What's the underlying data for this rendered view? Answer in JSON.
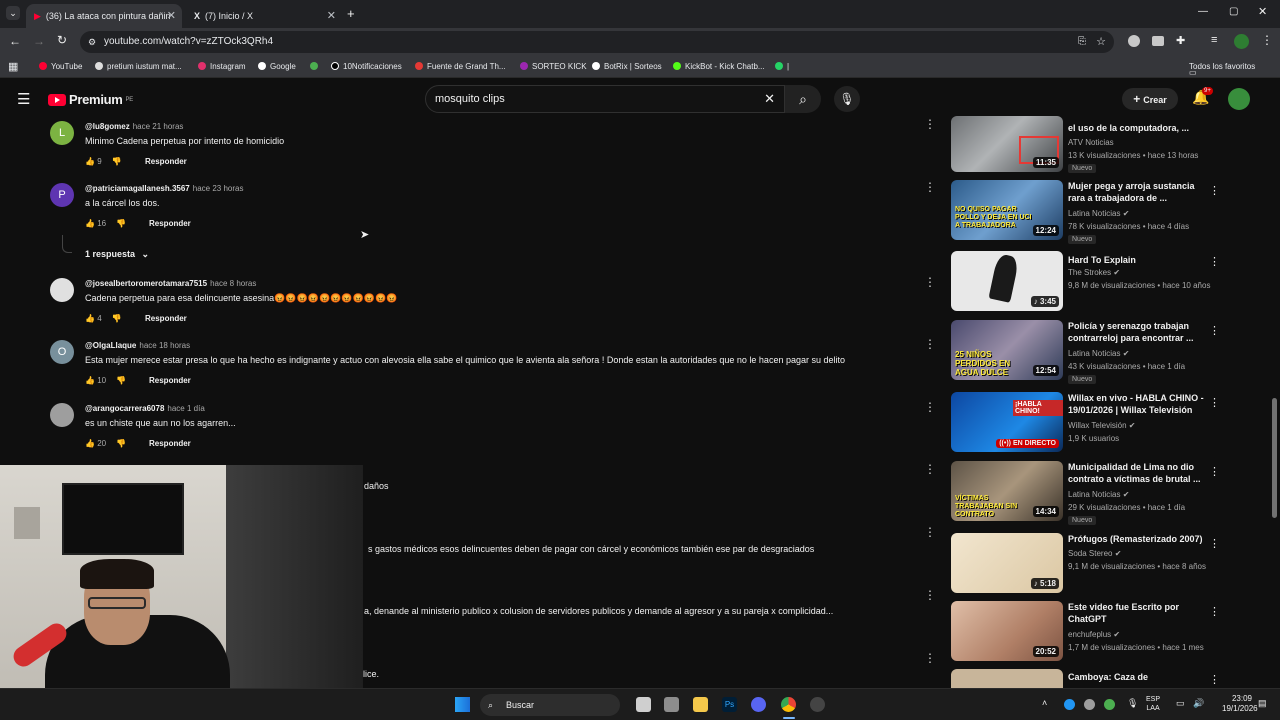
{
  "browser": {
    "tabs": [
      {
        "title": "(36) La ataca con pintura dañin"
      },
      {
        "title": "(7) Inicio / X"
      }
    ],
    "url": "youtube.com/watch?v=zZTOck3QRh4",
    "bookmarks": [
      "YouTube",
      "pretium iustum mat...",
      "Instagram",
      "Google",
      "10Notificaciones",
      "Fuente de Grand Th...",
      "SORTEO KICK",
      "BotRix | Sorteos",
      "KickBot - Kick Chatb...",
      "|"
    ],
    "all_favorites": "Todos los favoritos"
  },
  "youtube": {
    "logo": "Premium",
    "region": "PE",
    "search_query": "mosquito clips",
    "create_label": "Crear",
    "notif_count": "9+"
  },
  "comments": [
    {
      "handle": "@lu8gomez",
      "time": "hace 21 horas",
      "text": "Minimo Cadena perpetua por intento de homicidio",
      "likes": "9",
      "reply": "Responder",
      "avatar_letter": "L",
      "avatar_color": "#7cb342"
    },
    {
      "handle": "@patriciamagallanesh.3567",
      "time": "hace 23 horas",
      "text": "a la cárcel los dos.",
      "likes": "16",
      "reply": "Responder",
      "avatar_letter": "P",
      "avatar_color": "#5e35b1"
    },
    {
      "handle": "@josealbertoromerotamara7515",
      "time": "hace 8 horas",
      "text": "Cadena perpetua para esa delincuente asesina😡😡😡😡😡😡😡😡😡😡😡",
      "likes": "4",
      "reply": "Responder",
      "avatar_letter": "",
      "avatar_color": "#e0e0e0"
    },
    {
      "handle": "@OlgaLlaque",
      "time": "hace 18 horas",
      "text": "Esta mujer merece estar presa lo que ha hecho es indignante y actuo con alevosia ella sabe  el  quimico que le avienta ala señora ! Donde estan la autoridades que no le hacen pagar su delito",
      "likes": "10",
      "reply": "Responder",
      "avatar_letter": "O",
      "avatar_color": "#78909c"
    },
    {
      "handle": "@arangocarrera6078",
      "time": "hace 1 día",
      "text": "es un chiste que aun no los agarren...",
      "likes": "20",
      "reply": "Responder",
      "avatar_letter": "",
      "avatar_color": "#9e9e9e"
    }
  ],
  "replies_toggle": "1 respuesta",
  "partial_comments": [
    "daños",
    "s gastos médicos esos delincuentes deben de pagar con cárcel y económicos también ese par de desgraciados",
    "a, denande al ministerio publico x colusion de servidores publicos y demande al agresor y a su pareja x complicidad...",
    "lice."
  ],
  "sidebar": [
    {
      "title": "el uso de la computadora, ...",
      "channel": "ATV Noticias",
      "meta": "13 K visualizaciones • hace 13 horas",
      "badge": "Nuevo",
      "duration": "11:35",
      "thumb_color": "#8a8d8f",
      "overlay": ""
    },
    {
      "title": "Mujer pega y arroja sustancia rara a trabajadora de ...",
      "channel": "Latina Noticias",
      "meta": "78 K visualizaciones • hace 4 días",
      "badge": "Nuevo",
      "duration": "12:24",
      "thumb_color": "#3f6fa0",
      "overlay": "NO QUISO PAGAR POLLO Y DEJA EN UCI A TRABAJADORA"
    },
    {
      "title": "Hard To Explain",
      "channel": "The Strokes",
      "meta": "9,8 M de visualizaciones • hace 10 años",
      "badge": "",
      "duration": "3:45",
      "thumb_color": "#e8e8e8",
      "overlay": ""
    },
    {
      "title": "Policía y serenazgo trabajan contrarreloj para encontrar ...",
      "channel": "Latina Noticias",
      "meta": "43 K visualizaciones • hace 1 día",
      "badge": "Nuevo",
      "duration": "12:54",
      "thumb_color": "#6e6a8a",
      "overlay": "25 NIÑOS PERDIDOS EN AGUA DULCE"
    },
    {
      "title": "Willax en vivo - HABLA CHINO - 19/01/2026 | Willax Televisión",
      "channel": "Willax Televisión",
      "meta": "1,9 K usuarios",
      "badge": "",
      "duration": "EN DIRECTO",
      "thumb_color": "#1f5fae",
      "overlay": "¡HABLA CHINO!"
    },
    {
      "title": "Municipalidad de Lima no dio contrato a víctimas de brutal ...",
      "channel": "Latina Noticias",
      "meta": "29 K visualizaciones • hace 1 día",
      "badge": "Nuevo",
      "duration": "14:34",
      "thumb_color": "#7a6c5a",
      "overlay": "VÍCTIMAS TRABAJABAN SIN CONTRATO"
    },
    {
      "title": "Prófugos (Remasterizado 2007)",
      "channel": "Soda Stereo",
      "meta": "9,1 M de visualizaciones • hace 8 años",
      "badge": "",
      "duration": "5:18",
      "thumb_color": "#e9d9b8",
      "overlay": ""
    },
    {
      "title": "Este video fue Escrito por ChatGPT",
      "channel": "enchufeplus",
      "meta": "1,7 M de visualizaciones • hace 1 mes",
      "badge": "",
      "duration": "20:52",
      "thumb_color": "#c9a08a",
      "overlay": ""
    },
    {
      "title": "Camboya: Caza de",
      "channel": "",
      "meta": "",
      "badge": "",
      "duration": "",
      "thumb_color": "#c8b59a",
      "overlay": ""
    }
  ],
  "taskbar": {
    "search": "Buscar",
    "lang": "ESP",
    "region": "LAA",
    "time": "23:09",
    "date": "19/1/2026"
  }
}
